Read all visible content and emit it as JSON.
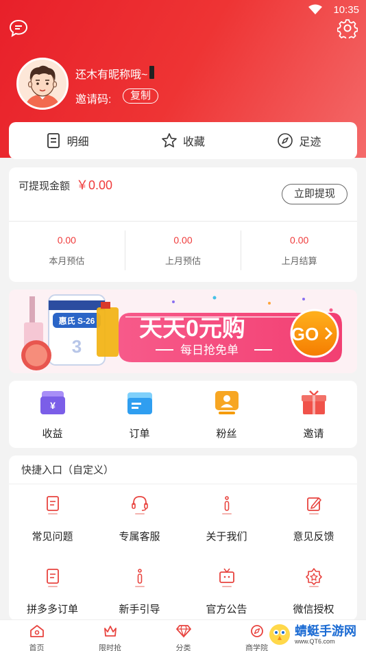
{
  "status_bar": {
    "time": "10:35"
  },
  "profile": {
    "nickname": "还木有昵称哦~",
    "invite_label": "邀请码:",
    "copy_label": "复制"
  },
  "tabs": [
    {
      "label": "明细",
      "icon": "list-icon"
    },
    {
      "label": "收藏",
      "icon": "star-icon"
    },
    {
      "label": "足迹",
      "icon": "compass-icon"
    }
  ],
  "wallet": {
    "label": "可提现金额",
    "amount": "￥0.00",
    "withdraw_label": "立即提现",
    "stats": [
      {
        "value": "0.00",
        "name": "本月预估"
      },
      {
        "value": "0.00",
        "name": "上月预估"
      },
      {
        "value": "0.00",
        "name": "上月结算"
      }
    ]
  },
  "banner": {
    "headline": "天天0元购",
    "sub": "每日抢免单",
    "go": "GO",
    "product_text": "惠氏 S-26"
  },
  "features": [
    {
      "label": "收益",
      "icon": "wallet-icon",
      "color": "#8a6ff0"
    },
    {
      "label": "订单",
      "icon": "order-icon",
      "color": "#3aa8f2"
    },
    {
      "label": "粉丝",
      "icon": "fans-icon",
      "color": "#f7a623"
    },
    {
      "label": "邀请",
      "icon": "gift-icon",
      "color": "#f0524a"
    }
  ],
  "quick": {
    "title": "快捷入口（自定义）",
    "items": [
      {
        "label": "常见问题",
        "icon": "document-icon"
      },
      {
        "label": "专属客服",
        "icon": "headset-icon"
      },
      {
        "label": "关于我们",
        "icon": "info-icon"
      },
      {
        "label": "意见反馈",
        "icon": "edit-icon"
      },
      {
        "label": "拼多多订单",
        "icon": "document-icon"
      },
      {
        "label": "新手引导",
        "icon": "info-icon"
      },
      {
        "label": "官方公告",
        "icon": "tv-icon"
      },
      {
        "label": "微信授权",
        "icon": "badge-icon"
      }
    ]
  },
  "bottom_nav": [
    {
      "label": "首页",
      "icon": "home-icon"
    },
    {
      "label": "限时抢",
      "icon": "crown-icon"
    },
    {
      "label": "分类",
      "icon": "diamond-icon"
    },
    {
      "label": "商学院",
      "icon": "compass-icon"
    }
  ],
  "watermark": {
    "title": "蜻蜓手游网",
    "url": "www.QT6.com"
  },
  "colors": {
    "accent": "#ef3a3a",
    "header_start": "#e8202a",
    "header_end": "#f46a6a"
  }
}
